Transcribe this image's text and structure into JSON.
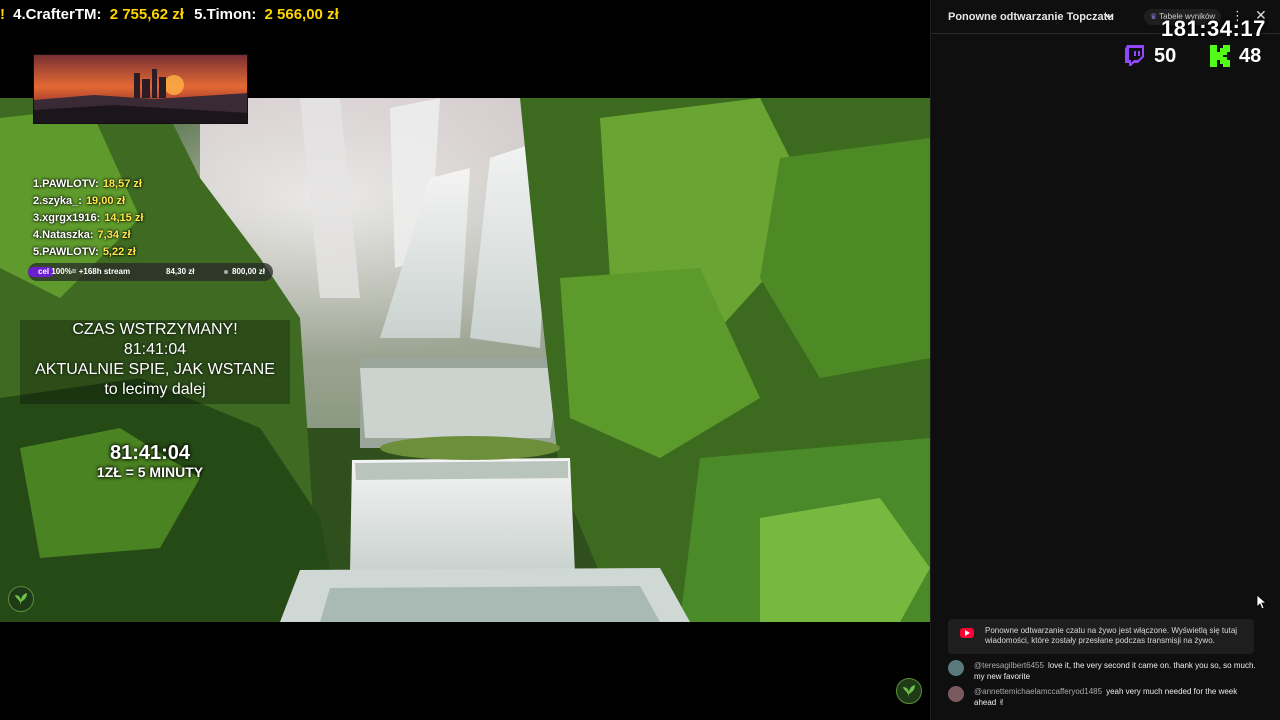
{
  "ticker": {
    "items": [
      {
        "name": "4.CrafterTM:",
        "amount": "2 755,62 zł"
      },
      {
        "name": "5.Timon:",
        "amount": "2 566,00 zł"
      }
    ]
  },
  "tips": [
    {
      "label": "1.PAWLOTV:",
      "amount": "18,57 zł"
    },
    {
      "label": "2.szyka_:",
      "amount": "19,00 zł"
    },
    {
      "label": "3.xgrgx1916:",
      "amount": "14,15 zł"
    },
    {
      "label": "4.Nataszka:",
      "amount": "7,34 zł"
    },
    {
      "label": "5.PAWLOTV:",
      "amount": "5,22 zł"
    }
  ],
  "goal": {
    "text": "cel 100%= +168h stream",
    "current": "84,30 zł",
    "target": "800,00 zł",
    "progress_fraction": 0.105,
    "fill_color": "#6b1fd1"
  },
  "paused": {
    "line1": "CZAS WSTRZYMANY!",
    "line2": "81:41:04",
    "line3": "AKTUALNIE SPIE, JAK WSTANE",
    "line4": "to lecimy dalej"
  },
  "timer": {
    "value": "81:41:04",
    "rate": "1ZŁ = 5 MINUTY"
  },
  "chat": {
    "title": "Ponowne odtwarzanie Topczatu",
    "leaderboard_label": "Tabele wyników",
    "clock": "181:34:17",
    "twitch_count": "50",
    "kick_count": "48",
    "replay_notice": "Ponowne odtwarzanie czatu na żywo jest włączone. Wyświetlą się tutaj wiadomości, które zostały przesłane podczas transmisji na żywo.",
    "messages": [
      {
        "author": "@teresagilbert6455",
        "text": "love it, the very second it came on. thank you so, so much. my new favorite"
      },
      {
        "author": "@annettemichaelamccafferyod1485",
        "text": "yeah very much needed for the week ahead ✌"
      }
    ]
  },
  "colors": {
    "amount_yellow": "#ffd400",
    "twitch_purple": "#9146ff",
    "kick_green": "#53fc18",
    "youtube_red": "#ff0033"
  }
}
